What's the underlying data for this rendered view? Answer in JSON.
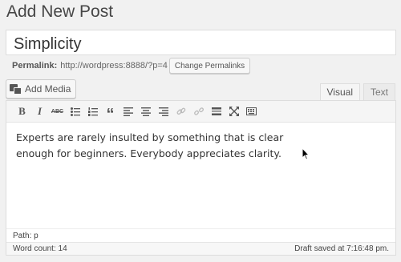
{
  "page": {
    "title": "Add New Post"
  },
  "post": {
    "title_value": "Simplicity",
    "permalink_label": "Permalink:",
    "permalink_url": "http://wordpress:8888/?p=4",
    "change_permalinks_label": "Change Permalinks"
  },
  "media": {
    "add_media_label": "Add Media",
    "icon": "media-icon"
  },
  "tabs": [
    {
      "label": "Visual",
      "active": true
    },
    {
      "label": "Text",
      "active": false
    }
  ],
  "toolbar": {
    "buttons": [
      {
        "name": "bold",
        "glyph": "B"
      },
      {
        "name": "italic",
        "glyph": "I"
      },
      {
        "name": "strikethrough",
        "glyph": "ABC"
      },
      {
        "name": "bullet-list",
        "icon": "bullet-list-icon"
      },
      {
        "name": "numbered-list",
        "icon": "numbered-list-icon"
      },
      {
        "name": "blockquote",
        "glyph": "“"
      },
      {
        "name": "align-left",
        "icon": "align-left-icon"
      },
      {
        "name": "align-center",
        "icon": "align-center-icon"
      },
      {
        "name": "align-right",
        "icon": "align-right-icon"
      },
      {
        "name": "insert-link",
        "icon": "link-icon",
        "disabled": true
      },
      {
        "name": "remove-link",
        "icon": "unlink-icon",
        "disabled": true
      },
      {
        "name": "read-more",
        "icon": "read-more-icon"
      },
      {
        "name": "fullscreen",
        "icon": "fullscreen-icon"
      },
      {
        "name": "toolbar-toggle",
        "icon": "kitchen-sink-icon"
      }
    ]
  },
  "editor": {
    "content": "Experts are rarely insulted by something that is clear enough for beginners. Everybody appreciates clarity.",
    "path": "Path: p",
    "word_count": "Word count: 14",
    "draft_status": "Draft saved at 7:16:48 pm."
  }
}
